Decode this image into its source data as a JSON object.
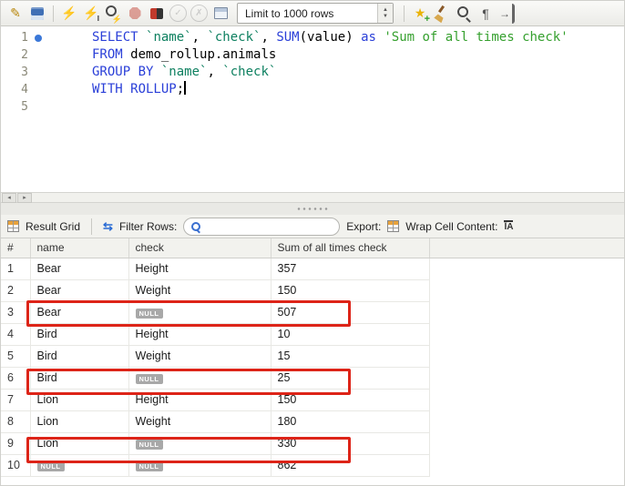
{
  "toolbar": {
    "limit_dropdown": {
      "value": "Limit to 1000 rows"
    },
    "icons_file": [
      {
        "name": "new-sql-tab-icon",
        "glyph": "✎",
        "color": "#b8860b"
      },
      {
        "name": "save-script-icon",
        "shape": "floppy"
      }
    ],
    "icons_exec": [
      {
        "name": "execute-script-icon",
        "glyph": "⚡",
        "color": "#d9a400"
      },
      {
        "name": "execute-statement-icon",
        "shape": "bolti",
        "glyph": "⚡",
        "color": "#d9a400"
      },
      {
        "name": "explain-plan-icon",
        "shape": "magbolt"
      },
      {
        "name": "stop-query-icon",
        "shape": "octagon",
        "dim": true
      },
      {
        "name": "stop-on-error-toggle-icon",
        "shape": "toggle"
      },
      {
        "name": "commit-icon",
        "shape": "circle",
        "glyph": "✓",
        "color": "#9a9a9a",
        "dim": true
      },
      {
        "name": "rollback-icon",
        "shape": "circle",
        "glyph": "✗",
        "color": "#9a9a9a",
        "dim": true
      },
      {
        "name": "autocommit-toggle-icon",
        "shape": "box"
      }
    ],
    "icons_right": [
      {
        "name": "save-snippet-icon",
        "shape": "starplus",
        "glyph": "★",
        "color": "#eab308"
      },
      {
        "name": "beautify-query-icon",
        "shape": "broom"
      },
      {
        "name": "find-icon",
        "shape": "mag"
      },
      {
        "name": "show-invisibles-icon",
        "glyph": "¶",
        "color": "#555555"
      },
      {
        "name": "toggle-wrap-icon",
        "shape": "indent",
        "glyph": "→",
        "color": "#555555"
      }
    ]
  },
  "editor": {
    "colors": {
      "keyword": "#2a3fd8",
      "identifier": "#0e8060",
      "string": "#35a02e",
      "plain": "#000000"
    },
    "lines": [
      {
        "n": "1",
        "marker": true,
        "seg": [
          [
            "kw",
            "SELECT "
          ],
          [
            "id",
            "`name`"
          ],
          [
            "pl",
            ", "
          ],
          [
            "id",
            "`check`"
          ],
          [
            "pl",
            ", "
          ],
          [
            "kw",
            "SUM"
          ],
          [
            "pl",
            "(value) "
          ],
          [
            "kw",
            "as "
          ],
          [
            "str",
            "'Sum of all times check'"
          ]
        ]
      },
      {
        "n": "2",
        "seg": [
          [
            "kw",
            "FROM "
          ],
          [
            "pl",
            "demo_rollup.animals"
          ]
        ]
      },
      {
        "n": "3",
        "seg": [
          [
            "kw",
            "GROUP BY "
          ],
          [
            "id",
            "`name`"
          ],
          [
            "pl",
            ", "
          ],
          [
            "id",
            "`check`"
          ]
        ]
      },
      {
        "n": "4",
        "seg": [
          [
            "kw",
            "WITH ROLLUP"
          ],
          [
            "pl",
            ";"
          ]
        ],
        "cursor": true
      },
      {
        "n": "5",
        "seg": []
      }
    ]
  },
  "result_toolbar": {
    "title": "Result Grid",
    "refresh_icon_glyph": "⇆",
    "filter_label": "Filter Rows:",
    "search_value": "",
    "export_label": "Export:",
    "wrap_label": "Wrap Cell Content:",
    "wrap_icon_glyph": "ĪA"
  },
  "grid": {
    "columns": [
      "#",
      "name",
      "check",
      "Sum of all times check"
    ],
    "null_badge": "NULL",
    "rows": [
      {
        "num": "1",
        "name": "Bear",
        "check": "Height",
        "sum": "357"
      },
      {
        "num": "2",
        "name": "Bear",
        "check": "Weight",
        "sum": "150"
      },
      {
        "num": "3",
        "name": "Bear",
        "check": null,
        "sum": "507"
      },
      {
        "num": "4",
        "name": "Bird",
        "check": "Height",
        "sum": "10"
      },
      {
        "num": "5",
        "name": "Bird",
        "check": "Weight",
        "sum": "15"
      },
      {
        "num": "6",
        "name": "Bird",
        "check": null,
        "sum": "25"
      },
      {
        "num": "7",
        "name": "Lion",
        "check": "Height",
        "sum": "150"
      },
      {
        "num": "8",
        "name": "Lion",
        "check": "Weight",
        "sum": "180"
      },
      {
        "num": "9",
        "name": "Lion",
        "check": null,
        "sum": "330"
      },
      {
        "num": "10",
        "name": null,
        "check": null,
        "sum": "862"
      }
    ],
    "highlight_rows": [
      3,
      6,
      9
    ],
    "highlight_color": "#dd2418"
  }
}
